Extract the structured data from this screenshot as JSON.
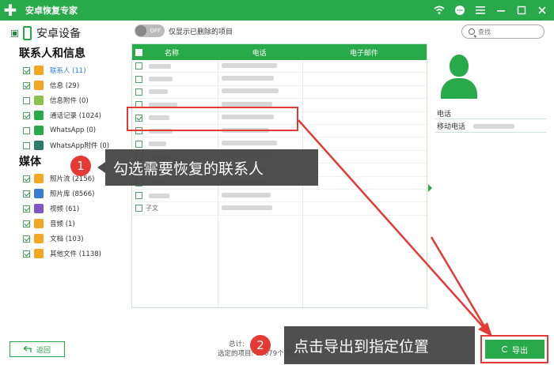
{
  "titlebar": {
    "app_title": "安卓恢复专家",
    "logo_glyph": "✚"
  },
  "sidebar": {
    "device_label": "安卓设备",
    "contacts_section": "联系人和信息",
    "media_section": "媒体",
    "items": [
      {
        "label": "联系人 (11)",
        "icon": "contacts-icon",
        "color": "#f5a623",
        "checked": true,
        "active": true
      },
      {
        "label": "信息 (29)",
        "icon": "message-icon",
        "color": "#f5a623",
        "checked": true
      },
      {
        "label": "信息附件 (0)",
        "icon": "attachment-icon",
        "color": "#8bc34a",
        "checked": false
      },
      {
        "label": "通话记录 (1024)",
        "icon": "call-log-icon",
        "color": "#28a94a",
        "checked": true
      },
      {
        "label": "WhatsApp (0)",
        "icon": "whatsapp-icon",
        "color": "#28a94a",
        "checked": false
      },
      {
        "label": "WhatsApp附件 (0)",
        "icon": "whatsapp-attachment-icon",
        "color": "#2e7d6a",
        "checked": false
      },
      {
        "label": "照片流 (2156)",
        "icon": "photo-stream-icon",
        "color": "#f5a623",
        "checked": true
      },
      {
        "label": "照片库 (8566)",
        "icon": "photo-library-icon",
        "color": "#3a7bd5",
        "checked": true
      },
      {
        "label": "视频 (61)",
        "icon": "video-icon",
        "color": "#7e57c2",
        "checked": true
      },
      {
        "label": "音频 (1)",
        "icon": "audio-icon",
        "color": "#f5a623",
        "checked": true
      },
      {
        "label": "文档 (103)",
        "icon": "document-icon",
        "color": "#f5a623",
        "checked": true
      },
      {
        "label": "其他文件 (1138)",
        "icon": "other-files-icon",
        "color": "#f5a623",
        "checked": true
      }
    ]
  },
  "toolbar": {
    "toggle_state": "OFF",
    "toggle_label": "仅显示已删除的项目",
    "search_placeholder": "查找"
  },
  "table": {
    "columns": [
      "名称",
      "电话",
      "电子邮件"
    ],
    "rows": [
      {
        "name": "",
        "checked": false
      },
      {
        "name": "",
        "checked": false
      },
      {
        "name": "",
        "checked": false
      },
      {
        "name": "",
        "checked": false
      },
      {
        "name": "",
        "checked": true
      },
      {
        "name": "",
        "checked": false
      },
      {
        "name": "",
        "checked": false
      },
      {
        "name": "",
        "checked": false
      },
      {
        "name": "",
        "checked": false
      },
      {
        "name": "",
        "checked": false
      },
      {
        "name": "",
        "checked": false
      },
      {
        "name": "子文",
        "checked": false
      }
    ]
  },
  "detail": {
    "phone_header": "电话",
    "mobile_label": "移动电话"
  },
  "bottom": {
    "back_label": "返回",
    "stats_total": "总计:",
    "stats_selected": "选定的项目: 13079个项目，",
    "export_label": "导出"
  },
  "annotations": {
    "step1_number": "1",
    "step1_text": "勾选需要恢复的联系人",
    "step2_number": "2",
    "step2_text": "点击导出到指定位置"
  }
}
